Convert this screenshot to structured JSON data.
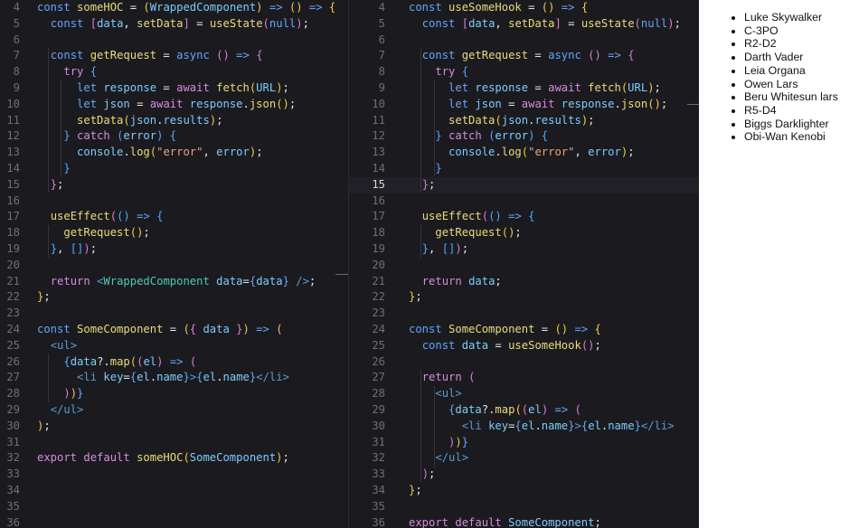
{
  "left_editor": {
    "line_numbers": [
      "4",
      "5",
      "6",
      "7",
      "8",
      "9",
      "10",
      "11",
      "12",
      "13",
      "14",
      "15",
      "16",
      "17",
      "18",
      "19",
      "20",
      "21",
      "22",
      "23",
      "24",
      "25",
      "26",
      "27",
      "28",
      "29",
      "30",
      "31",
      "32",
      "33",
      "34",
      "35",
      "36"
    ],
    "lines": [
      [
        [
          "kw",
          "const "
        ],
        [
          "fn",
          "someHOC"
        ],
        [
          "plain",
          " = "
        ],
        [
          "p1",
          "("
        ],
        [
          "id",
          "WrappedComponent"
        ],
        [
          "p1",
          ")"
        ],
        [
          "kw",
          " => "
        ],
        [
          "p1",
          "()"
        ],
        [
          "kw",
          " => "
        ],
        [
          "p1",
          "{"
        ]
      ],
      [
        [
          "plain",
          "  "
        ],
        [
          "kw",
          "const "
        ],
        [
          "p2",
          "["
        ],
        [
          "id",
          "data"
        ],
        [
          "plain",
          ", "
        ],
        [
          "fn",
          "setData"
        ],
        [
          "p2",
          "]"
        ],
        [
          "plain",
          " = "
        ],
        [
          "fn",
          "useState"
        ],
        [
          "p2",
          "("
        ],
        [
          "kw",
          "null"
        ],
        [
          "p2",
          ")"
        ],
        [
          "plain",
          ";"
        ]
      ],
      [],
      [
        [
          "plain",
          "  "
        ],
        [
          "kw",
          "const "
        ],
        [
          "fn",
          "getRequest"
        ],
        [
          "plain",
          " = "
        ],
        [
          "kw",
          "async "
        ],
        [
          "p2",
          "()"
        ],
        [
          "kw",
          " => "
        ],
        [
          "p2",
          "{"
        ]
      ],
      [
        [
          "plain",
          "    "
        ],
        [
          "ctl",
          "try "
        ],
        [
          "p3",
          "{"
        ]
      ],
      [
        [
          "plain",
          "      "
        ],
        [
          "kw",
          "let "
        ],
        [
          "id",
          "response"
        ],
        [
          "plain",
          " = "
        ],
        [
          "ctl",
          "await "
        ],
        [
          "fn",
          "fetch"
        ],
        [
          "p1",
          "("
        ],
        [
          "id",
          "URL"
        ],
        [
          "p1",
          ")"
        ],
        [
          "plain",
          ";"
        ]
      ],
      [
        [
          "plain",
          "      "
        ],
        [
          "kw",
          "let "
        ],
        [
          "id",
          "json"
        ],
        [
          "plain",
          " = "
        ],
        [
          "ctl",
          "await "
        ],
        [
          "id",
          "response"
        ],
        [
          "plain",
          "."
        ],
        [
          "fn",
          "json"
        ],
        [
          "p1",
          "()"
        ],
        [
          "plain",
          ";"
        ]
      ],
      [
        [
          "plain",
          "      "
        ],
        [
          "fn",
          "setData"
        ],
        [
          "p1",
          "("
        ],
        [
          "id",
          "json"
        ],
        [
          "plain",
          "."
        ],
        [
          "id",
          "results"
        ],
        [
          "p1",
          ")"
        ],
        [
          "plain",
          ";"
        ]
      ],
      [
        [
          "plain",
          "    "
        ],
        [
          "p3",
          "}"
        ],
        [
          "ctl",
          " catch "
        ],
        [
          "p3",
          "("
        ],
        [
          "id",
          "error"
        ],
        [
          "p3",
          ") {"
        ]
      ],
      [
        [
          "plain",
          "      "
        ],
        [
          "id",
          "console"
        ],
        [
          "plain",
          "."
        ],
        [
          "fn",
          "log"
        ],
        [
          "p1",
          "("
        ],
        [
          "str",
          "\"error\""
        ],
        [
          "plain",
          ", "
        ],
        [
          "id",
          "error"
        ],
        [
          "p1",
          ")"
        ],
        [
          "plain",
          ";"
        ]
      ],
      [
        [
          "plain",
          "    "
        ],
        [
          "p3",
          "}"
        ]
      ],
      [
        [
          "plain",
          "  "
        ],
        [
          "p2",
          "}"
        ],
        [
          "plain",
          ";"
        ]
      ],
      [],
      [
        [
          "plain",
          "  "
        ],
        [
          "fn",
          "useEffect"
        ],
        [
          "p2",
          "("
        ],
        [
          "p3",
          "()"
        ],
        [
          "kw",
          " => "
        ],
        [
          "p3",
          "{"
        ]
      ],
      [
        [
          "plain",
          "    "
        ],
        [
          "fn",
          "getRequest"
        ],
        [
          "p1",
          "()"
        ],
        [
          "plain",
          ";"
        ]
      ],
      [
        [
          "plain",
          "  "
        ],
        [
          "p3",
          "}"
        ],
        [
          "plain",
          ", "
        ],
        [
          "p3",
          "[]"
        ],
        [
          "p2",
          ")"
        ],
        [
          "plain",
          ";"
        ]
      ],
      [],
      [
        [
          "plain",
          "  "
        ],
        [
          "ctl",
          "return "
        ],
        [
          "tag",
          "<"
        ],
        [
          "cls",
          "WrappedComponent"
        ],
        [
          "plain",
          " "
        ],
        [
          "id",
          "data"
        ],
        [
          "plain",
          "="
        ],
        [
          "kw",
          "{"
        ],
        [
          "id",
          "data"
        ],
        [
          "kw",
          "}"
        ],
        [
          "tag",
          " />"
        ],
        [
          "plain",
          ";"
        ]
      ],
      [
        [
          "p1",
          "}"
        ],
        [
          "plain",
          ";"
        ]
      ],
      [],
      [
        [
          "kw",
          "const "
        ],
        [
          "fn",
          "SomeComponent"
        ],
        [
          "plain",
          " = "
        ],
        [
          "p1",
          "("
        ],
        [
          "p2",
          "{ "
        ],
        [
          "id",
          "data"
        ],
        [
          "p2",
          " }"
        ],
        [
          "p1",
          ")"
        ],
        [
          "kw",
          " => "
        ],
        [
          "p1",
          "("
        ]
      ],
      [
        [
          "plain",
          "  "
        ],
        [
          "tag",
          "<ul>"
        ]
      ],
      [
        [
          "plain",
          "    "
        ],
        [
          "kw",
          "{"
        ],
        [
          "id",
          "data"
        ],
        [
          "plain",
          "?."
        ],
        [
          "fn",
          "map"
        ],
        [
          "p1",
          "("
        ],
        [
          "p2",
          "("
        ],
        [
          "id",
          "el"
        ],
        [
          "p2",
          ")"
        ],
        [
          "kw",
          " => "
        ],
        [
          "p2",
          "("
        ]
      ],
      [
        [
          "plain",
          "      "
        ],
        [
          "tag",
          "<li "
        ],
        [
          "id",
          "key"
        ],
        [
          "plain",
          "="
        ],
        [
          "kw",
          "{"
        ],
        [
          "id",
          "el"
        ],
        [
          "plain",
          "."
        ],
        [
          "id",
          "name"
        ],
        [
          "kw",
          "}"
        ],
        [
          "tag",
          ">"
        ],
        [
          "kw",
          "{"
        ],
        [
          "id",
          "el"
        ],
        [
          "plain",
          "."
        ],
        [
          "id",
          "name"
        ],
        [
          "kw",
          "}"
        ],
        [
          "tag",
          "</li>"
        ]
      ],
      [
        [
          "plain",
          "    "
        ],
        [
          "p2",
          ")"
        ],
        [
          "p1",
          ")"
        ],
        [
          "kw",
          "}"
        ]
      ],
      [
        [
          "plain",
          "  "
        ],
        [
          "tag",
          "</ul>"
        ]
      ],
      [
        [
          "p1",
          ")"
        ],
        [
          "plain",
          ";"
        ]
      ],
      [],
      [
        [
          "ctl",
          "export default "
        ],
        [
          "fn",
          "someHOC"
        ],
        [
          "p1",
          "("
        ],
        [
          "id",
          "SomeComponent"
        ],
        [
          "p1",
          ")"
        ],
        [
          "plain",
          ";"
        ]
      ],
      [],
      [],
      [],
      []
    ]
  },
  "right_editor": {
    "line_numbers": [
      "4",
      "5",
      "6",
      "7",
      "8",
      "9",
      "10",
      "11",
      "12",
      "13",
      "14",
      "15",
      "16",
      "17",
      "18",
      "19",
      "20",
      "21",
      "22",
      "23",
      "24",
      "25",
      "26",
      "27",
      "28",
      "29",
      "30",
      "31",
      "32",
      "33",
      "34",
      "35",
      "36"
    ],
    "active_line": "15",
    "lines": [
      [
        [
          "kw",
          "const "
        ],
        [
          "fn",
          "useSomeHook"
        ],
        [
          "plain",
          " = "
        ],
        [
          "p1",
          "()"
        ],
        [
          "kw",
          " => "
        ],
        [
          "p1",
          "{"
        ]
      ],
      [
        [
          "plain",
          "  "
        ],
        [
          "kw",
          "const "
        ],
        [
          "p2",
          "["
        ],
        [
          "id",
          "data"
        ],
        [
          "plain",
          ", "
        ],
        [
          "fn",
          "setData"
        ],
        [
          "p2",
          "]"
        ],
        [
          "plain",
          " = "
        ],
        [
          "fn",
          "useState"
        ],
        [
          "p2",
          "("
        ],
        [
          "kw",
          "null"
        ],
        [
          "p2",
          ")"
        ],
        [
          "plain",
          ";"
        ]
      ],
      [],
      [
        [
          "plain",
          "  "
        ],
        [
          "kw",
          "const "
        ],
        [
          "fn",
          "getRequest"
        ],
        [
          "plain",
          " = "
        ],
        [
          "kw",
          "async "
        ],
        [
          "p2",
          "()"
        ],
        [
          "kw",
          " => "
        ],
        [
          "p2",
          "{"
        ]
      ],
      [
        [
          "plain",
          "    "
        ],
        [
          "ctl",
          "try "
        ],
        [
          "p3",
          "{"
        ]
      ],
      [
        [
          "plain",
          "      "
        ],
        [
          "kw",
          "let "
        ],
        [
          "id",
          "response"
        ],
        [
          "plain",
          " = "
        ],
        [
          "ctl",
          "await "
        ],
        [
          "fn",
          "fetch"
        ],
        [
          "p1",
          "("
        ],
        [
          "id",
          "URL"
        ],
        [
          "p1",
          ")"
        ],
        [
          "plain",
          ";"
        ]
      ],
      [
        [
          "plain",
          "      "
        ],
        [
          "kw",
          "let "
        ],
        [
          "id",
          "json"
        ],
        [
          "plain",
          " = "
        ],
        [
          "ctl",
          "await "
        ],
        [
          "id",
          "response"
        ],
        [
          "plain",
          "."
        ],
        [
          "fn",
          "json"
        ],
        [
          "p1",
          "()"
        ],
        [
          "plain",
          ";"
        ]
      ],
      [
        [
          "plain",
          "      "
        ],
        [
          "fn",
          "setData"
        ],
        [
          "p1",
          "("
        ],
        [
          "id",
          "json"
        ],
        [
          "plain",
          "."
        ],
        [
          "id",
          "results"
        ],
        [
          "p1",
          ")"
        ],
        [
          "plain",
          ";"
        ]
      ],
      [
        [
          "plain",
          "    "
        ],
        [
          "p3",
          "}"
        ],
        [
          "ctl",
          " catch "
        ],
        [
          "p3",
          "("
        ],
        [
          "id",
          "error"
        ],
        [
          "p3",
          ") {"
        ]
      ],
      [
        [
          "plain",
          "      "
        ],
        [
          "id",
          "console"
        ],
        [
          "plain",
          "."
        ],
        [
          "fn",
          "log"
        ],
        [
          "p1",
          "("
        ],
        [
          "str",
          "\"error\""
        ],
        [
          "plain",
          ", "
        ],
        [
          "id",
          "error"
        ],
        [
          "p1",
          ")"
        ],
        [
          "plain",
          ";"
        ]
      ],
      [
        [
          "plain",
          "    "
        ],
        [
          "p3",
          "}"
        ]
      ],
      [
        [
          "plain",
          "  "
        ],
        [
          "p2",
          "}"
        ],
        [
          "plain",
          ";"
        ]
      ],
      [],
      [
        [
          "plain",
          "  "
        ],
        [
          "fn",
          "useEffect"
        ],
        [
          "p2",
          "("
        ],
        [
          "p3",
          "()"
        ],
        [
          "kw",
          " => "
        ],
        [
          "p3",
          "{"
        ]
      ],
      [
        [
          "plain",
          "    "
        ],
        [
          "fn",
          "getRequest"
        ],
        [
          "p1",
          "()"
        ],
        [
          "plain",
          ";"
        ]
      ],
      [
        [
          "plain",
          "  "
        ],
        [
          "p3",
          "}"
        ],
        [
          "plain",
          ", "
        ],
        [
          "p3",
          "[]"
        ],
        [
          "p2",
          ")"
        ],
        [
          "plain",
          ";"
        ]
      ],
      [],
      [
        [
          "plain",
          "  "
        ],
        [
          "ctl",
          "return "
        ],
        [
          "id",
          "data"
        ],
        [
          "plain",
          ";"
        ]
      ],
      [
        [
          "p1",
          "}"
        ],
        [
          "plain",
          ";"
        ]
      ],
      [],
      [
        [
          "kw",
          "const "
        ],
        [
          "fn",
          "SomeComponent"
        ],
        [
          "plain",
          " = "
        ],
        [
          "p1",
          "()"
        ],
        [
          "kw",
          " => "
        ],
        [
          "p1",
          "{"
        ]
      ],
      [
        [
          "plain",
          "  "
        ],
        [
          "kw",
          "const "
        ],
        [
          "id",
          "data"
        ],
        [
          "plain",
          " = "
        ],
        [
          "fn",
          "useSomeHook"
        ],
        [
          "p2",
          "()"
        ],
        [
          "plain",
          ";"
        ]
      ],
      [],
      [
        [
          "plain",
          "  "
        ],
        [
          "ctl",
          "return "
        ],
        [
          "p2",
          "("
        ]
      ],
      [
        [
          "plain",
          "    "
        ],
        [
          "tag",
          "<ul>"
        ]
      ],
      [
        [
          "plain",
          "      "
        ],
        [
          "kw",
          "{"
        ],
        [
          "id",
          "data"
        ],
        [
          "plain",
          "?."
        ],
        [
          "fn",
          "map"
        ],
        [
          "p1",
          "("
        ],
        [
          "p2",
          "("
        ],
        [
          "id",
          "el"
        ],
        [
          "p2",
          ")"
        ],
        [
          "kw",
          " => "
        ],
        [
          "p2",
          "("
        ]
      ],
      [
        [
          "plain",
          "        "
        ],
        [
          "tag",
          "<li "
        ],
        [
          "id",
          "key"
        ],
        [
          "plain",
          "="
        ],
        [
          "kw",
          "{"
        ],
        [
          "id",
          "el"
        ],
        [
          "plain",
          "."
        ],
        [
          "id",
          "name"
        ],
        [
          "kw",
          "}"
        ],
        [
          "tag",
          ">"
        ],
        [
          "kw",
          "{"
        ],
        [
          "id",
          "el"
        ],
        [
          "plain",
          "."
        ],
        [
          "id",
          "name"
        ],
        [
          "kw",
          "}"
        ],
        [
          "tag",
          "</li>"
        ]
      ],
      [
        [
          "plain",
          "      "
        ],
        [
          "p2",
          ")"
        ],
        [
          "p1",
          ")"
        ],
        [
          "kw",
          "}"
        ]
      ],
      [
        [
          "plain",
          "    "
        ],
        [
          "tag",
          "</ul>"
        ]
      ],
      [
        [
          "plain",
          "  "
        ],
        [
          "p2",
          ")"
        ],
        [
          "plain",
          ";"
        ]
      ],
      [
        [
          "p1",
          "}"
        ],
        [
          "plain",
          ";"
        ]
      ],
      [],
      [
        [
          "ctl",
          "export default "
        ],
        [
          "id",
          "SomeComponent"
        ],
        [
          "plain",
          ";"
        ]
      ]
    ]
  },
  "output": {
    "items": [
      "Luke Skywalker",
      "C-3PO",
      "R2-D2",
      "Darth Vader",
      "Leia Organa",
      "Owen Lars",
      "Beru Whitesun lars",
      "R5-D4",
      "Biggs Darklighter",
      "Obi-Wan Kenobi"
    ]
  }
}
